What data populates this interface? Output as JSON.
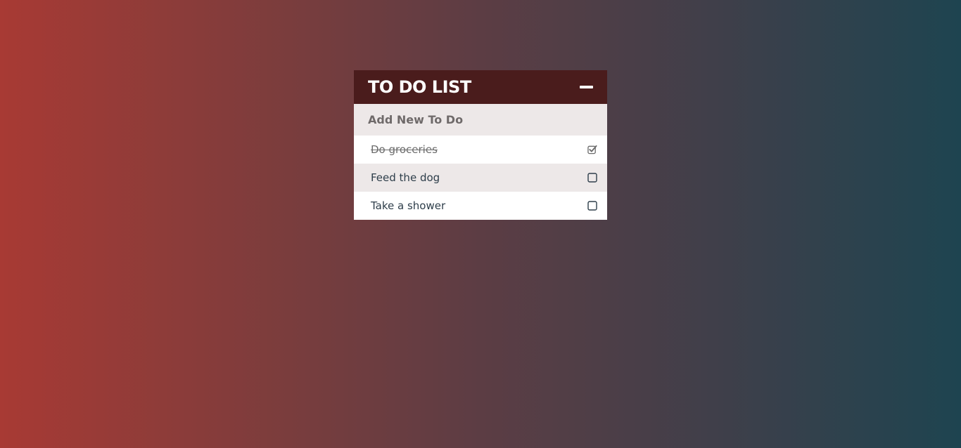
{
  "header": {
    "title": "TO DO LIST",
    "collapse_icon": "minus-icon"
  },
  "add_input": {
    "placeholder": "Add New To Do",
    "value": ""
  },
  "todos": [
    {
      "label": "Do groceries",
      "done": true,
      "icon": "checked-checkbox-icon"
    },
    {
      "label": "Feed the dog",
      "done": false,
      "icon": "empty-checkbox-icon"
    },
    {
      "label": "Take a shower",
      "done": false,
      "icon": "empty-checkbox-icon"
    }
  ],
  "colors": {
    "header_bg": "#4a1c1c",
    "row_alt_bg": "#ede8e8",
    "text": "#2e3e4a",
    "gradient_left": "#a83a34",
    "gradient_right": "#1e4450"
  }
}
